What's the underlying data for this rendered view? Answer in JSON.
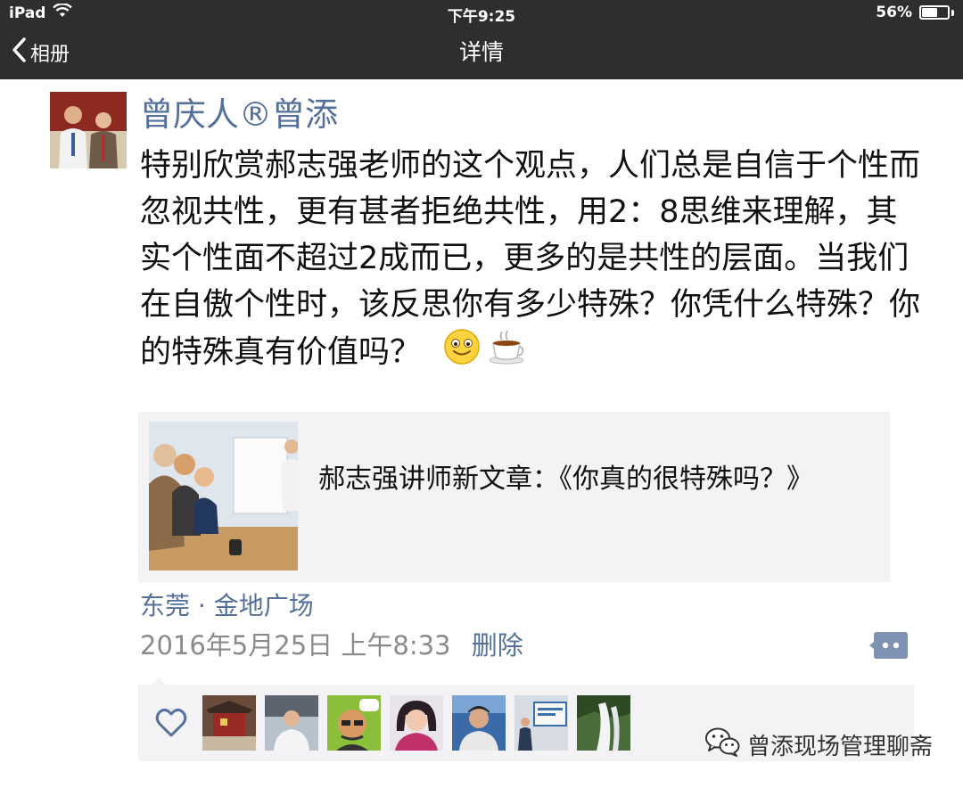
{
  "status_bar": {
    "device": "iPad",
    "time": "下午9:25",
    "battery": "56%",
    "battery_level": 0.56
  },
  "nav": {
    "back_label": "相册",
    "title": "详情"
  },
  "post": {
    "author": "曾庆人®曾添",
    "text": "特别欣赏郝志强老师的这个观点，人们总是自信于个性而忽视共性，更有甚者拒绝共性，用2：8思维来理解，其实个性面不超过2成而已，更多的是共性的层面。当我们在自傲个性时，该反思你有多少特殊？你凭什么特殊？你的特殊真有价值吗？",
    "emojis": [
      "smile-emoji",
      "coffee-emoji"
    ],
    "link_title": "郝志强讲师新文章：《你真的很特殊吗？》",
    "location": "东莞 · 金地广场",
    "time": "2016年5月25日 上午8:33",
    "delete_label": "删除"
  },
  "likes": {
    "avatars": [
      "like-avatar-1",
      "like-avatar-2",
      "like-avatar-3",
      "like-avatar-4",
      "like-avatar-5",
      "like-avatar-6",
      "like-avatar-7"
    ]
  },
  "watermark": {
    "text": "曾添现场管理聊斋"
  },
  "colors": {
    "accent": "#55709b",
    "navbar": "#2e2e30",
    "card_bg": "#f3f3f5",
    "time_gray": "#8a8a8a"
  }
}
